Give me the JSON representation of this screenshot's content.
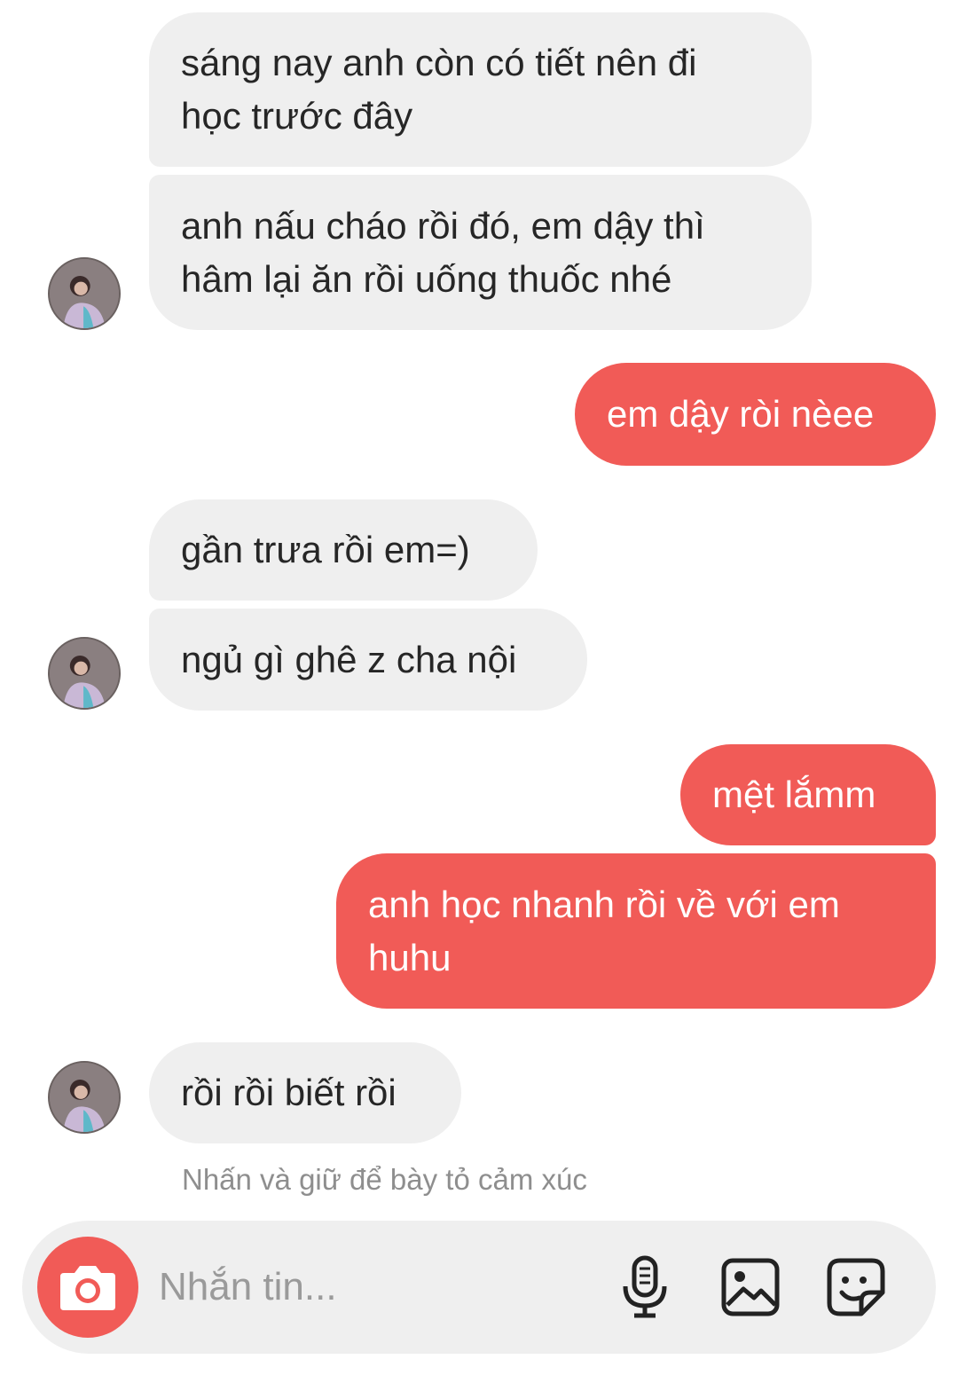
{
  "conversation": {
    "messages": [
      {
        "from": "received",
        "text": "sáng nay anh còn có tiết nên đi\nhọc trước đây"
      },
      {
        "from": "received",
        "text": "anh nấu cháo rồi đó, em dậy thì\nhâm lại ăn rồi uống thuốc nhé"
      },
      {
        "from": "sent",
        "text": "em dậy ròi nèee"
      },
      {
        "from": "received",
        "text": "gần trưa rồi em=)"
      },
      {
        "from": "received",
        "text": "ngủ gì ghê z cha nội"
      },
      {
        "from": "sent",
        "text": "mệt lắmm"
      },
      {
        "from": "sent",
        "text": "anh học nhanh rồi về với em\nhuhu"
      },
      {
        "from": "received",
        "text": "rồi rồi biết rồi"
      }
    ],
    "reaction_hint": "Nhấn và giữ để bày tỏ cảm xúc"
  },
  "composer": {
    "placeholder": "Nhắn tin...",
    "camera_icon": "camera-icon",
    "mic_icon": "microphone-icon",
    "gallery_icon": "gallery-icon",
    "sticker_icon": "sticker-icon"
  },
  "colors": {
    "sent_bubble": "#f15b57",
    "received_bubble": "#efefef",
    "received_text": "#262626",
    "hint_text": "#8e8e8e"
  }
}
